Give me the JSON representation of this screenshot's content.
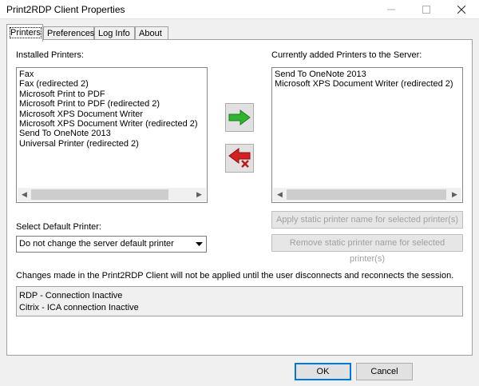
{
  "window": {
    "title": "Print2RDP Client  Properties"
  },
  "tabs": [
    {
      "label": "Printers",
      "active": true
    },
    {
      "label": "Preferences",
      "active": false
    },
    {
      "label": "Log Info",
      "active": false
    },
    {
      "label": "About",
      "active": false
    }
  ],
  "printers": {
    "installed_label": "Installed Printers:",
    "installed": [
      "Fax",
      "Fax (redirected 2)",
      "Microsoft Print to PDF",
      "Microsoft Print to PDF (redirected 2)",
      "Microsoft XPS Document Writer",
      "Microsoft XPS Document Writer (redirected 2)",
      "Send To OneNote 2013",
      "Universal Printer (redirected 2)"
    ],
    "server_label": "Currently added Printers to the Server:",
    "server": [
      "Send To OneNote 2013",
      "Microsoft XPS Document Writer (redirected 2)"
    ],
    "default_label": "Select Default Printer:",
    "default_value": "Do not change the server default printer",
    "apply_static_label": "Apply static printer name for selected printer(s)",
    "remove_static_label": "Remove static printer name for selected printer(s)",
    "notice": "Changes made in the Print2RDP Client will not be applied until the user disconnects and reconnects the session.",
    "status": [
      "RDP - Connection Inactive",
      "Citrix - ICA connection Inactive"
    ]
  },
  "icons": {
    "add": "green-right-arrow-icon",
    "remove": "red-left-arrow-with-x-icon",
    "accent_green": "#2fb52f",
    "accent_red": "#d42020"
  },
  "footer": {
    "ok_label": "OK",
    "cancel_label": "Cancel"
  }
}
